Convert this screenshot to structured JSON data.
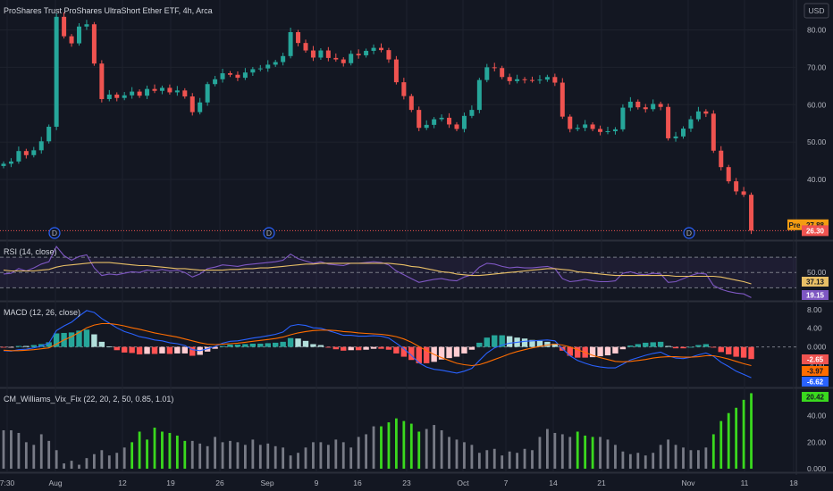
{
  "header": {
    "title": "ProShares Trust ProShares UltraShort Ether ETF, 4h, Arca",
    "currency_button": "USD"
  },
  "colors": {
    "background": "#131722",
    "grid": "#1e222d",
    "up": "#26a69a",
    "down": "#ef5350",
    "rsi_line": "#7e57c2",
    "rsi_ma": "#e8bf66",
    "macd_line": "#2962ff",
    "signal_line": "#ff6d00",
    "vix_gray": "#787b86",
    "vix_lime": "#3ad91e"
  },
  "x_axis_labels": [
    "7:30",
    "Aug",
    "12",
    "19",
    "26",
    "Sep",
    "9",
    "16",
    "23",
    "Oct",
    "7",
    "14",
    "21",
    "Nov",
    "11",
    "18"
  ],
  "dividend_marker": "D",
  "chart_data": [
    {
      "type": "candlestick",
      "pane": "price",
      "ylim": [
        24,
        88
      ],
      "y_ticks": [
        "80.00",
        "70.00",
        "60.00",
        "50.00",
        "40.00"
      ],
      "close": [
        44.2,
        44.8,
        47.6,
        46.5,
        47.8,
        50.2,
        54.1,
        83.5,
        78.3,
        76.4,
        80.9,
        81.5,
        71.0,
        61.5,
        62.7,
        61.8,
        62.5,
        63.5,
        62.4,
        64.2,
        63.7,
        64.5,
        63.3,
        63.8,
        62.2,
        58.0,
        60.6,
        65.5,
        66.8,
        68.4,
        68.0,
        67.2,
        68.6,
        69.5,
        69.7,
        70.7,
        71.4,
        73.0,
        79.4,
        76.5,
        74.5,
        72.6,
        74.5,
        72.5,
        72.1,
        71.1,
        73.6,
        73.2,
        74.4,
        75.2,
        74.6,
        72.1,
        66.0,
        62.3,
        58.6,
        53.8,
        54.6,
        56.1,
        56.5,
        54.7,
        53.5,
        57.0,
        58.6,
        66.6,
        70.0,
        69.8,
        67.4,
        66.3,
        66.8,
        66.6,
        66.5,
        66.7,
        67.4,
        65.9,
        56.8,
        53.5,
        53.8,
        54.7,
        53.5,
        52.7,
        52.9,
        53.4,
        59.2,
        60.8,
        59.3,
        58.8,
        60.2,
        59.4,
        51.0,
        51.5,
        53.6,
        56.1,
        58.2,
        57.6,
        47.7,
        43.3,
        39.5,
        36.8,
        35.9,
        26.3
      ]
    },
    {
      "type": "line",
      "pane": "rsi",
      "legend": "RSI (14, close)",
      "ylim": [
        14,
        90
      ],
      "y_ticks": [
        "50.00"
      ],
      "series": [
        {
          "values": [
            48,
            49,
            55,
            52,
            56,
            61,
            64,
            84,
            72,
            66,
            71,
            73,
            56,
            46,
            48,
            47,
            49,
            51,
            50,
            53,
            52,
            54,
            52,
            53,
            50,
            44,
            48,
            55,
            57,
            60,
            59,
            58,
            60,
            61,
            62,
            63,
            64,
            66,
            74,
            68,
            65,
            62,
            64,
            61,
            60,
            59,
            62,
            62,
            63,
            64,
            63,
            60,
            52,
            47,
            42,
            37,
            39,
            41,
            42,
            40,
            39,
            44,
            47,
            57,
            62,
            61,
            58,
            56,
            57,
            56,
            56,
            57,
            58,
            55,
            42,
            38,
            39,
            41,
            39,
            38,
            38,
            39,
            49,
            51,
            48,
            47,
            49,
            48,
            37,
            38,
            42,
            46,
            49,
            48,
            33,
            28,
            25,
            23,
            22,
            17
          ]
        },
        {
          "values": [
            53,
            52,
            52,
            52,
            52,
            53,
            54,
            57,
            59,
            60,
            61,
            62,
            63,
            63,
            63,
            62,
            61,
            60,
            59,
            59,
            58,
            57,
            56,
            55,
            55,
            54,
            53,
            53,
            53,
            53,
            54,
            54,
            55,
            55,
            56,
            56,
            57,
            58,
            59,
            60,
            61,
            61,
            62,
            62,
            62,
            62,
            62,
            62,
            62,
            62,
            62,
            62,
            61,
            60,
            58,
            57,
            55,
            53,
            51,
            50,
            48,
            47,
            46,
            46,
            47,
            48,
            49,
            50,
            51,
            52,
            53,
            54,
            55,
            55,
            54,
            53,
            51,
            50,
            49,
            48,
            47,
            46,
            46,
            46,
            46,
            46,
            46,
            46,
            46,
            45,
            45,
            45,
            45,
            45,
            45,
            44,
            42,
            40,
            38,
            35
          ]
        }
      ],
      "value_tags": [
        "37.13",
        "19.15"
      ]
    },
    {
      "type": "line",
      "pane": "macd",
      "legend": "MACD (12, 26, close)",
      "ylim": [
        -8.5,
        9.5
      ],
      "y_ticks": [
        "8.00",
        "4.00",
        "0.000",
        "-4.00"
      ],
      "series": [
        {
          "values": [
            -0.8,
            -0.9,
            -0.6,
            -0.5,
            -0.2,
            0.2,
            0.8,
            3.5,
            4.5,
            5.3,
            6.6,
            7.8,
            7.4,
            6.1,
            5.1,
            4.1,
            3.3,
            2.8,
            2.2,
            1.9,
            1.5,
            1.3,
            0.9,
            0.7,
            0.3,
            -0.6,
            -0.8,
            -0.4,
            0.1,
            0.8,
            1.2,
            1.3,
            1.6,
            1.9,
            2.1,
            2.4,
            2.7,
            3.2,
            4.5,
            4.8,
            4.6,
            4.1,
            4.0,
            3.5,
            3.0,
            2.5,
            2.5,
            2.3,
            2.3,
            2.4,
            2.3,
            1.9,
            0.8,
            -0.4,
            -1.8,
            -3.4,
            -4.3,
            -4.8,
            -5.0,
            -5.3,
            -5.6,
            -5.2,
            -4.6,
            -2.9,
            -1.3,
            -0.2,
            0.4,
            0.8,
            1.0,
            1.2,
            1.3,
            1.4,
            1.5,
            1.3,
            -0.4,
            -1.9,
            -2.9,
            -3.5,
            -4.0,
            -4.3,
            -4.5,
            -4.5,
            -3.7,
            -2.8,
            -2.3,
            -1.8,
            -1.4,
            -1.1,
            -1.9,
            -2.4,
            -2.5,
            -2.2,
            -1.7,
            -1.3,
            -2.0,
            -3.3,
            -4.2,
            -5.2,
            -5.9,
            -6.6
          ]
        },
        {
          "values": [
            -0.7,
            -0.8,
            -0.8,
            -0.7,
            -0.6,
            -0.4,
            -0.2,
            0.6,
            1.5,
            2.2,
            3.1,
            4.1,
            4.7,
            5.0,
            5.0,
            4.8,
            4.5,
            4.1,
            3.8,
            3.4,
            3.0,
            2.7,
            2.4,
            2.1,
            1.7,
            1.3,
            0.9,
            0.6,
            0.5,
            0.6,
            0.7,
            0.8,
            1.0,
            1.2,
            1.4,
            1.6,
            1.8,
            2.1,
            2.6,
            3.0,
            3.3,
            3.5,
            3.6,
            3.6,
            3.5,
            3.3,
            3.2,
            3.0,
            2.9,
            2.8,
            2.7,
            2.5,
            2.2,
            1.7,
            1.0,
            0.1,
            -0.8,
            -1.6,
            -2.3,
            -2.9,
            -3.5,
            -3.8,
            -4.0,
            -3.8,
            -3.3,
            -2.7,
            -2.1,
            -1.5,
            -1.0,
            -0.6,
            -0.2,
            0.1,
            0.4,
            0.6,
            0.4,
            0.0,
            -0.6,
            -1.2,
            -1.8,
            -2.3,
            -2.7,
            -3.1,
            -3.2,
            -3.1,
            -2.9,
            -2.7,
            -2.4,
            -2.2,
            -2.1,
            -2.1,
            -2.2,
            -2.2,
            -2.1,
            -1.9,
            -1.9,
            -2.2,
            -2.6,
            -3.1,
            -3.6,
            -4.0
          ]
        }
      ],
      "value_tags": [
        "-2.65",
        "-3.97",
        "-6.62"
      ]
    },
    {
      "type": "bar",
      "pane": "vix",
      "legend": "CM_Williams_Vix_Fix (22, 20, 2, 50, 0.85, 1.01)",
      "ylim": [
        -2,
        60
      ],
      "y_ticks": [
        "40.00",
        "20.00",
        "0.000"
      ],
      "values": [
        29,
        29,
        27,
        20,
        18,
        26,
        21,
        14,
        4,
        6,
        3,
        8,
        11,
        14,
        10,
        12,
        16,
        20,
        28,
        22,
        31,
        28,
        27,
        25,
        21,
        21,
        19,
        17,
        24,
        20,
        21,
        20,
        18,
        22,
        18,
        19,
        17,
        16,
        10,
        12,
        16,
        20,
        20,
        18,
        22,
        20,
        16,
        24,
        26,
        32,
        32,
        35,
        38,
        36,
        34,
        28,
        30,
        33,
        29,
        24,
        22,
        20,
        18,
        12,
        14,
        15,
        10,
        13,
        12,
        15,
        14,
        24,
        30,
        27,
        26,
        24,
        28,
        25,
        24,
        24,
        22,
        18,
        13,
        11,
        12,
        10,
        12,
        18,
        22,
        18,
        16,
        14,
        14,
        16,
        26,
        36,
        42,
        46,
        52,
        57
      ],
      "lime_bars": [
        17,
        18,
        19,
        20,
        21,
        22,
        23,
        24,
        50,
        51,
        52,
        53,
        54,
        55,
        76,
        77,
        78,
        94,
        95,
        96,
        97,
        98,
        99
      ],
      "value_tags": [
        "20.42"
      ]
    }
  ]
}
